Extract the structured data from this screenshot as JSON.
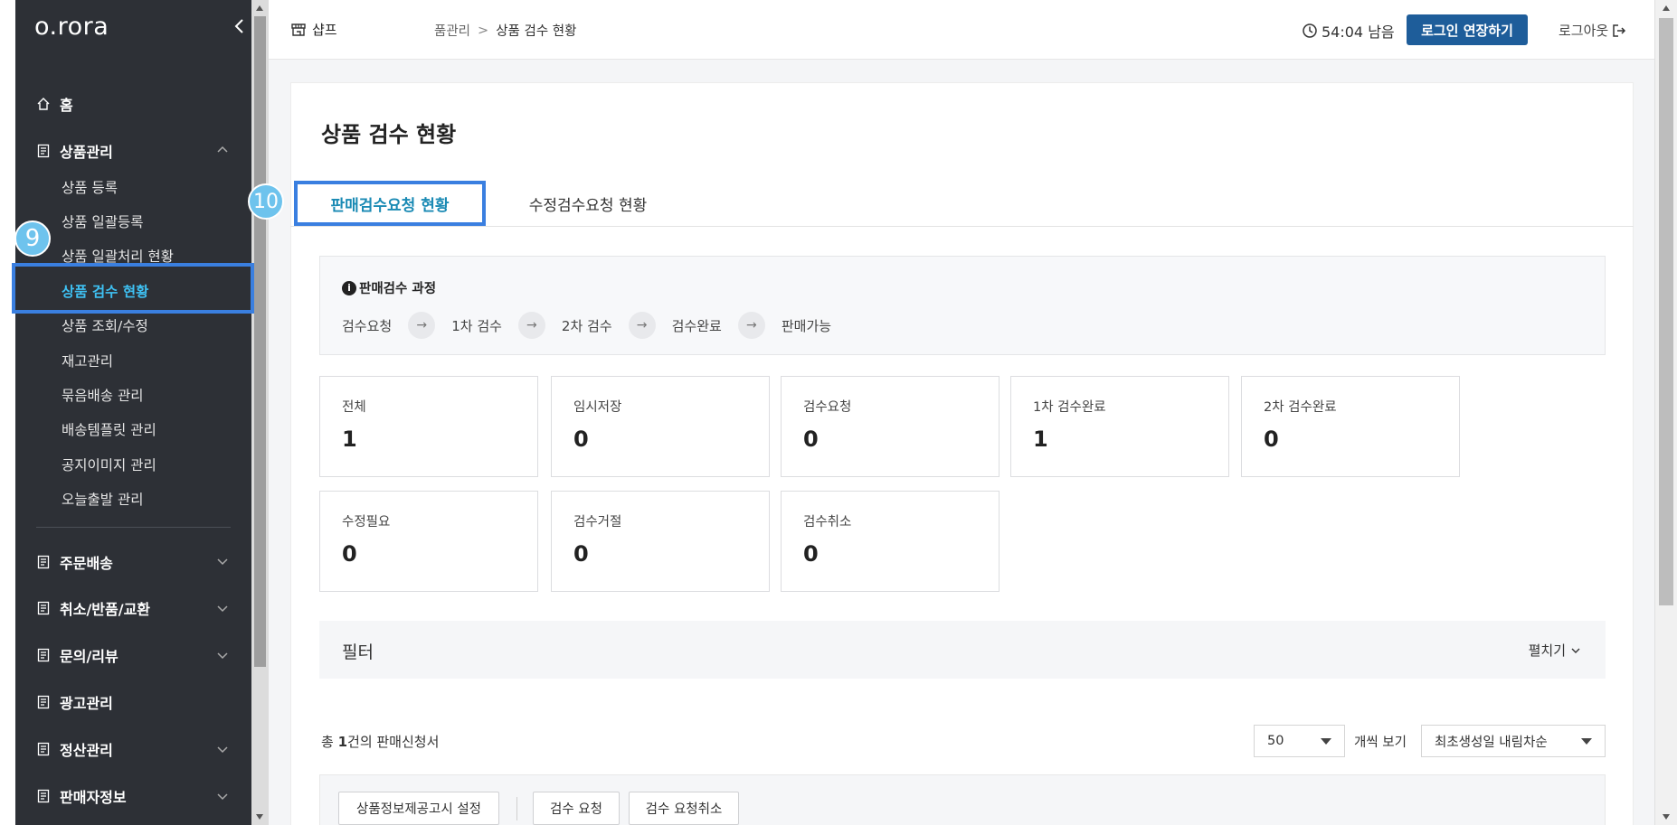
{
  "sidebar": {
    "logo": "o.rora",
    "home": "홈",
    "product_mgmt": "상품관리",
    "sub_items": [
      "상품 등록",
      "상품 일괄등록",
      "상품 일괄처리 현황",
      "상품 검수 현황",
      "상품 조회/수정",
      "재고관리",
      "묶음배송 관리",
      "배송템플릿 관리",
      "공지이미지 관리",
      "오늘출발 관리"
    ],
    "sections": [
      "주문배송",
      "취소/반품/교환",
      "문의/리뷰",
      "광고관리",
      "정산관리",
      "판매자정보"
    ],
    "active_color": "#3ec1f3"
  },
  "header": {
    "store_name": "샵프",
    "breadcrumb_parent": "품관리",
    "breadcrumb_sep": ">",
    "breadcrumb_current": "상품 검수 현황",
    "timer": "54:04 남음",
    "extend_label": "로그인 연장하기",
    "logout_label": "로그아웃",
    "accent": "#1e5d9a"
  },
  "page": {
    "title": "상품 검수 현황",
    "tabs": [
      "판매검수요청 현황",
      "수정검수요청 현황"
    ],
    "badges": [
      "10",
      "9"
    ]
  },
  "process": {
    "title": "판매검수 과정",
    "steps": [
      "검수요청",
      "1차 검수",
      "2차 검수",
      "검수완료",
      "판매가능"
    ]
  },
  "stats": [
    {
      "label": "전체",
      "value": "1"
    },
    {
      "label": "임시저장",
      "value": "0"
    },
    {
      "label": "검수요청",
      "value": "0"
    },
    {
      "label": "1차 검수완료",
      "value": "1"
    },
    {
      "label": "2차 검수완료",
      "value": "0"
    },
    {
      "label": "수정필요",
      "value": "0"
    },
    {
      "label": "검수거절",
      "value": "0"
    },
    {
      "label": "검수취소",
      "value": "0"
    }
  ],
  "filter": {
    "title": "필터",
    "expand_label": "펼치기"
  },
  "results": {
    "total_prefix": "총 ",
    "total_count": "1",
    "total_suffix": "건의 판매신청서",
    "page_size": "50",
    "page_size_label": "개씩 보기",
    "sort": "최초생성일 내림차순"
  },
  "actions": [
    "상품정보제공고시 설정",
    "검수 요청",
    "검수 요청취소"
  ]
}
